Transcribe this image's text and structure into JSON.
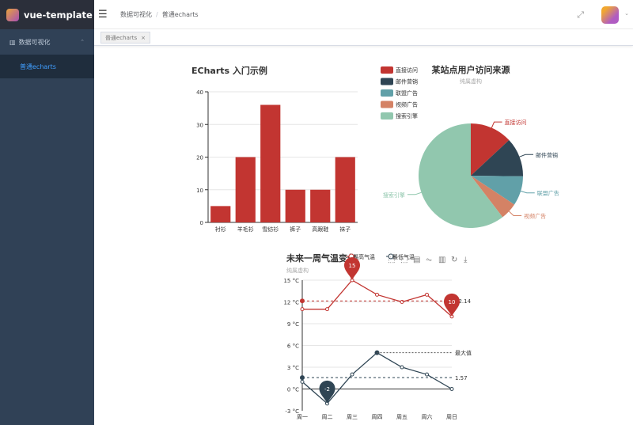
{
  "app": {
    "title": "vue-template"
  },
  "sidebar": {
    "menu": "数据可视化",
    "submenu": "普通echarts"
  },
  "header": {
    "breadcrumb": [
      "数据可视化",
      "普通echarts"
    ]
  },
  "tags": [
    {
      "label": "普通echarts",
      "close": "×"
    }
  ],
  "chart_data": [
    {
      "type": "bar",
      "title": "ECharts 入门示例",
      "categories": [
        "衬衫",
        "羊毛衫",
        "雪纺衫",
        "裤子",
        "高跟鞋",
        "袜子"
      ],
      "values": [
        5,
        20,
        36,
        10,
        10,
        20
      ],
      "ylim": [
        0,
        40
      ],
      "yticks": [
        0,
        10,
        20,
        30,
        40
      ],
      "color": "#c23531"
    },
    {
      "type": "pie",
      "title": "某站点用户访问来源",
      "subtitle": "纯属虚构",
      "legend_position": "top-left",
      "slices": [
        {
          "name": "直接访问",
          "value": 335,
          "color": "#c23531"
        },
        {
          "name": "邮件营销",
          "value": 310,
          "color": "#2f4554"
        },
        {
          "name": "联盟广告",
          "value": 234,
          "color": "#61a0a8"
        },
        {
          "name": "视频广告",
          "value": 135,
          "color": "#d48265"
        },
        {
          "name": "搜索引擎",
          "value": 1548,
          "color": "#91c7ae"
        }
      ]
    },
    {
      "type": "line",
      "title": "未来一周气温变化",
      "subtitle": "纯属虚构",
      "categories": [
        "周一",
        "周二",
        "周三",
        "周四",
        "周五",
        "周六",
        "周日"
      ],
      "ylim": [
        -3,
        15
      ],
      "yticks": [
        "-3 °C",
        "0 °C",
        "3 °C",
        "6 °C",
        "9 °C",
        "12 °C",
        "15 °C"
      ],
      "series": [
        {
          "name": "最高气温",
          "values": [
            11,
            11,
            15,
            13,
            12,
            13,
            10
          ],
          "color": "#c23531",
          "markpoints": [
            "15",
            "10"
          ],
          "average_label": "12.14"
        },
        {
          "name": "最低气温",
          "values": [
            1,
            -2,
            2,
            5,
            3,
            2,
            0
          ],
          "color": "#2f4554",
          "markpoints": [
            "-2"
          ],
          "average_label": "1.57",
          "max_label": "最大值"
        }
      ],
      "toolbox": [
        "zoom-icon",
        "zoom-reset-icon",
        "data-view-icon",
        "line-icon",
        "bar-icon",
        "restore-icon",
        "download-icon"
      ]
    }
  ]
}
